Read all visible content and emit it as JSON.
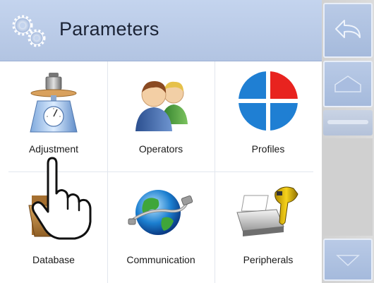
{
  "header": {
    "title": "Parameters",
    "icon": "gears-icon"
  },
  "tiles": [
    {
      "label": "Adjustment",
      "icon": "scale-weight-icon"
    },
    {
      "label": "Operators",
      "icon": "users-icon"
    },
    {
      "label": "Profiles",
      "icon": "profiles-pie-icon"
    },
    {
      "label": "Database",
      "icon": "folder-icon"
    },
    {
      "label": "Communication",
      "icon": "globe-cable-icon"
    },
    {
      "label": "Peripherals",
      "icon": "printer-scanner-icon"
    }
  ],
  "sidebar": {
    "buttons": [
      "undo-icon",
      "home-icon",
      "scroll-up-icon",
      "scroll-down-icon"
    ]
  },
  "colors": {
    "header_bg": "#b8c9e6",
    "sidebar_bg": "#d6d6d6",
    "profiles_red": "#e8231f",
    "profiles_blue": "#1f7fd3"
  }
}
